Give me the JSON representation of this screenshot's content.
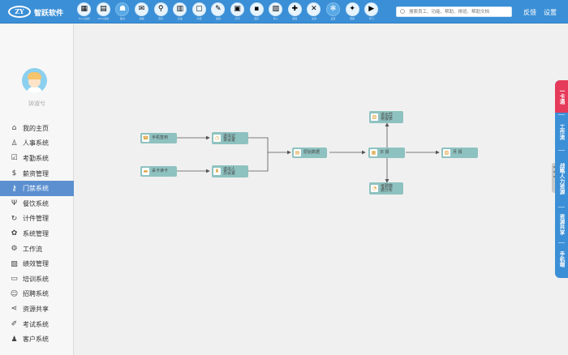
{
  "header": {
    "brand": "智跃软件",
    "logo_text": "ZY",
    "search_placeholder": "搜索员工、功能、帮助、排班、帮助文档",
    "feedback": "反馈",
    "settings": "设置",
    "toolbar": [
      {
        "label": "Excel资料",
        "icon": "excel-icon",
        "glyph": "▦"
      },
      {
        "label": "Word资料",
        "icon": "word-icon",
        "glyph": "▤"
      },
      {
        "label": "图书",
        "icon": "book-icon",
        "glyph": "☗",
        "alt": true
      },
      {
        "label": "信箱",
        "icon": "mail-icon",
        "glyph": "✉"
      },
      {
        "label": "查找",
        "icon": "search-icon",
        "glyph": "⚲"
      },
      {
        "label": "表格",
        "icon": "sheet-icon",
        "glyph": "▥"
      },
      {
        "label": "文档",
        "icon": "document-icon",
        "glyph": "▢"
      },
      {
        "label": "编辑",
        "icon": "pencil-icon",
        "glyph": "✎"
      },
      {
        "label": "打印",
        "icon": "print-icon",
        "glyph": "▣"
      },
      {
        "label": "保存",
        "icon": "save-icon",
        "glyph": "▪"
      },
      {
        "label": "导入",
        "icon": "import-icon",
        "glyph": "▧"
      },
      {
        "label": "刷新",
        "icon": "refresh-icon",
        "glyph": "✚"
      },
      {
        "label": "关闭",
        "icon": "close-icon",
        "glyph": "✕"
      },
      {
        "label": "设置",
        "icon": "gear-icon",
        "glyph": "✻",
        "alt": true
      },
      {
        "label": "帮助",
        "icon": "bulb-icon",
        "glyph": "✦"
      },
      {
        "label": "学习",
        "icon": "play-icon",
        "glyph": "▶"
      }
    ]
  },
  "sidebar": {
    "username": "钟淑兮",
    "items": [
      {
        "label": "我的主页",
        "icon": "home-icon",
        "glyph": "⌂"
      },
      {
        "label": "人事系统",
        "icon": "user-icon",
        "glyph": "♙"
      },
      {
        "label": "考勤系统",
        "icon": "calendar-check-icon",
        "glyph": "☑"
      },
      {
        "label": "薪资管理",
        "icon": "money-bag-icon",
        "glyph": "$"
      },
      {
        "label": "门禁系统",
        "icon": "key-icon",
        "glyph": "⚷",
        "active": true
      },
      {
        "label": "餐饮系统",
        "icon": "utensils-icon",
        "glyph": "Ψ"
      },
      {
        "label": "计件管理",
        "icon": "counter-icon",
        "glyph": "↻"
      },
      {
        "label": "系统管理",
        "icon": "gear-icon",
        "glyph": "✿"
      },
      {
        "label": "工作流",
        "icon": "workflow-icon",
        "glyph": "⚙"
      },
      {
        "label": "绩效管理",
        "icon": "chart-icon",
        "glyph": "▨"
      },
      {
        "label": "培训系统",
        "icon": "monitor-icon",
        "glyph": "▭"
      },
      {
        "label": "招聘系统",
        "icon": "recruit-icon",
        "glyph": "☺"
      },
      {
        "label": "资源共享",
        "icon": "share-icon",
        "glyph": "⋖"
      },
      {
        "label": "考试系统",
        "icon": "pen-icon",
        "glyph": "✐"
      },
      {
        "label": "客户系统",
        "icon": "client-icon",
        "glyph": "♟"
      }
    ]
  },
  "flow": {
    "nodes": {
      "phone": {
        "label": "手机签到",
        "icon": "phone-icon",
        "glyph": "☎"
      },
      "card_reader": {
        "label": "采卡读卡",
        "icon": "card-icon",
        "glyph": "▬"
      },
      "device_a": {
        "label": "进出记\n录设置",
        "icon": "clock-icon",
        "glyph": "◷"
      },
      "device_b": {
        "label": "进出人\n员设置",
        "icon": "person-icon",
        "glyph": "♜"
      },
      "raw": {
        "label": "原始数据",
        "icon": "data-icon",
        "glyph": "▤"
      },
      "daily": {
        "label": "日  报",
        "icon": "daily-icon",
        "glyph": "▦"
      },
      "exception": {
        "label": "进出异\n常报表",
        "icon": "exception-icon",
        "glyph": "▨"
      },
      "analysis": {
        "label": "考勤数\n据分析",
        "icon": "analysis-icon",
        "glyph": "◔"
      },
      "monthly": {
        "label": "月  报",
        "icon": "monthly-icon",
        "glyph": "▧"
      }
    }
  },
  "right_tabs": [
    "一卡通",
    "工作流",
    "战略人力资源",
    "资源共享",
    "手机端"
  ]
}
